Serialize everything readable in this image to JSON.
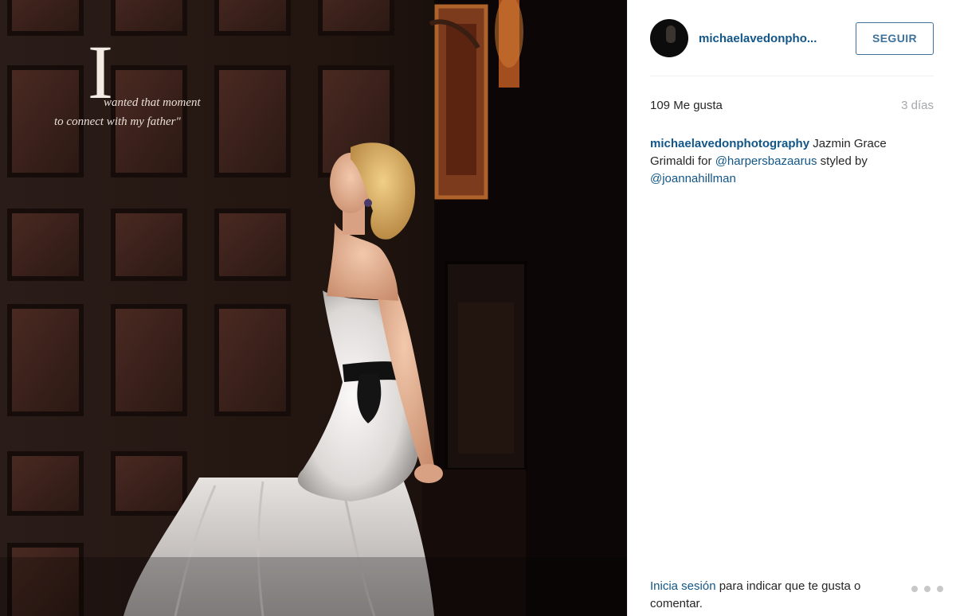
{
  "photo": {
    "quote_dropcap": "I",
    "quote_line1": "wanted that moment",
    "quote_line2": "to connect with my father\""
  },
  "header": {
    "username": "michaelavedonpho...",
    "follow_label": "SEGUIR"
  },
  "stats": {
    "likes": "109 Me gusta",
    "time_ago": "3 días"
  },
  "caption": {
    "user": "michaelavedonphotography",
    "text_1": " Jazmin Grace Grimaldi for ",
    "mention_1": "@harpersbazaarus",
    "text_2": " styled by ",
    "mention_2": "@joannahillman"
  },
  "footer": {
    "login_link": "Inicia sesión",
    "login_text": " para indicar que te gusta o comentar."
  },
  "icons": {
    "avatar": "profile-avatar",
    "more": "more-options-icon"
  },
  "colors": {
    "link_blue": "#125688",
    "follow_blue": "#3f729b",
    "muted_gray": "#a5a7aa"
  }
}
